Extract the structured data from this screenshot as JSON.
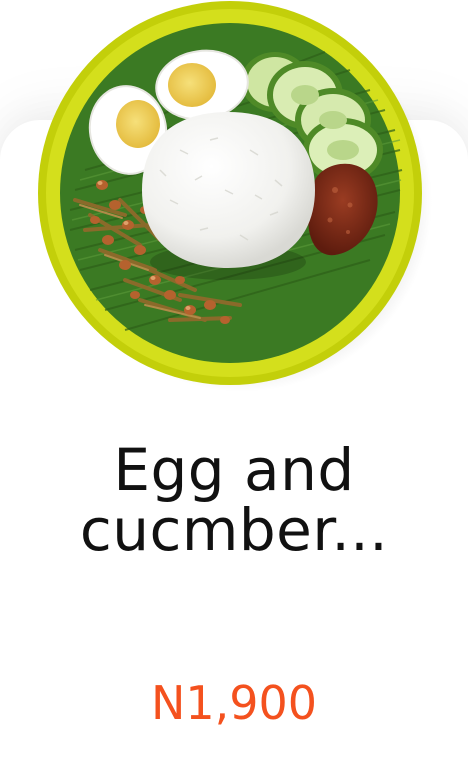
{
  "product": {
    "image_icon": "food-plate-icon",
    "name": "Egg and cucmber...",
    "price": "N1,900"
  },
  "colors": {
    "price": "#f4511e",
    "plate_rim": "#c8d40e",
    "leaf": "#3c7a25",
    "text": "#111111"
  }
}
